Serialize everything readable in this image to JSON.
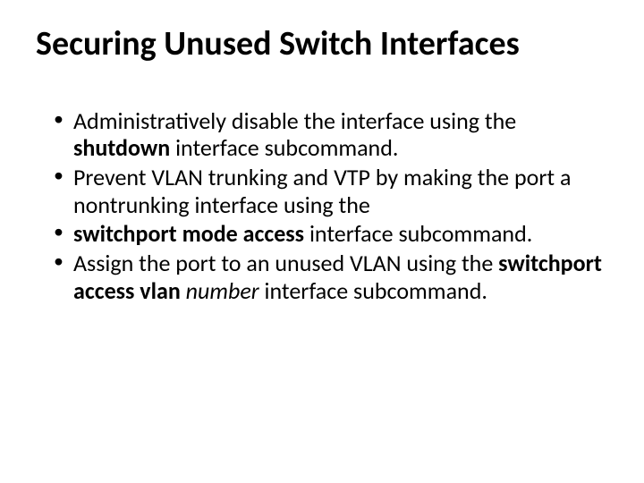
{
  "title": "Securing Unused Switch Interfaces",
  "bullets": [
    {
      "parts": [
        {
          "text": "Administratively disable the interface using the ",
          "style": ""
        },
        {
          "text": "shutdown",
          "style": "bold"
        },
        {
          "text": " interface subcommand.",
          "style": ""
        }
      ]
    },
    {
      "parts": [
        {
          "text": "Prevent VLAN trunking and VTP by making the port a nontrunking interface using the",
          "style": ""
        }
      ]
    },
    {
      "parts": [
        {
          "text": "switchport mode access ",
          "style": "bold"
        },
        {
          "text": "interface subcommand.",
          "style": ""
        }
      ]
    },
    {
      "parts": [
        {
          "text": " Assign the port to an unused VLAN using the ",
          "style": ""
        },
        {
          "text": "switchport access vlan ",
          "style": "bold"
        },
        {
          "text": "number",
          "style": "italic"
        },
        {
          "text": " interface subcommand.",
          "style": ""
        }
      ]
    }
  ]
}
